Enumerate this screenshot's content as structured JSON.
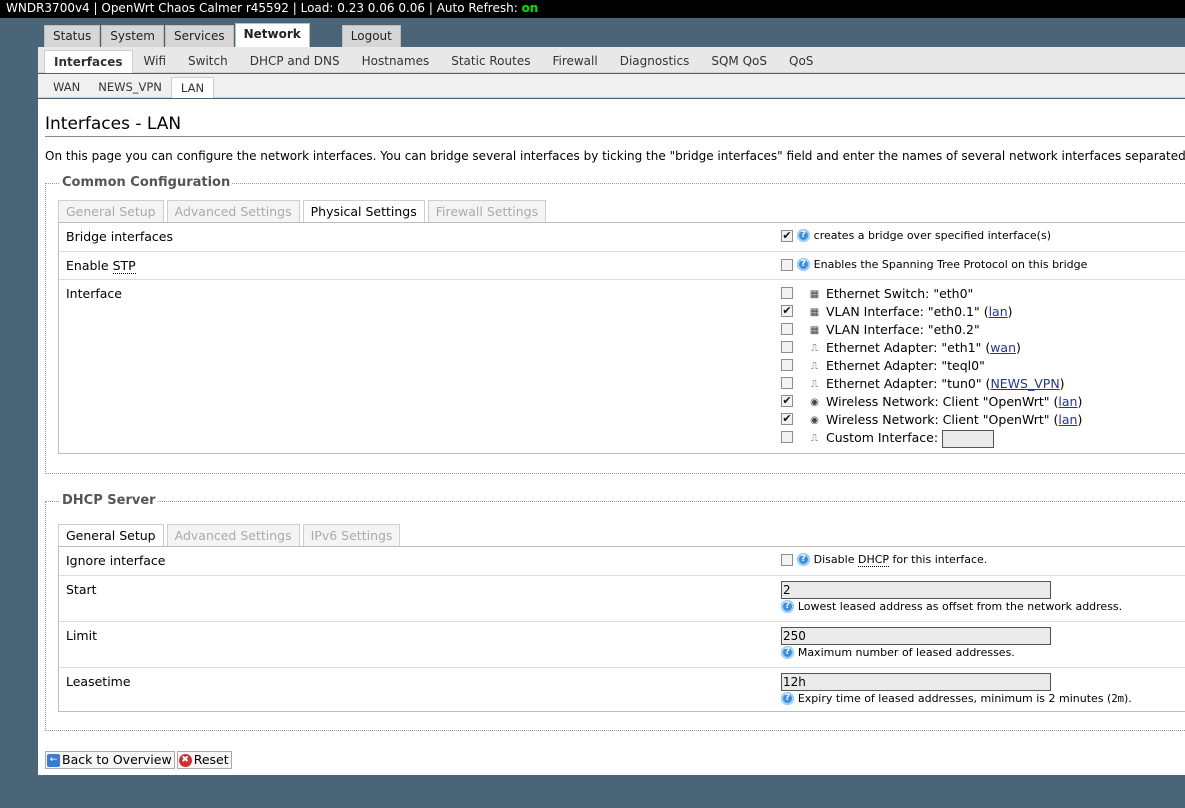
{
  "header": {
    "text": "WNDR3700v4 | OpenWrt Chaos Calmer r45592 | Load: 0.23 0.06 0.06 | Auto Refresh: ",
    "refresh_state": "on"
  },
  "main_tabs": [
    "Status",
    "System",
    "Services",
    "Network",
    "Logout"
  ],
  "network_tabs": [
    "Interfaces",
    "Wifi",
    "Switch",
    "DHCP and DNS",
    "Hostnames",
    "Static Routes",
    "Firewall",
    "Diagnostics",
    "SQM QoS",
    "QoS"
  ],
  "iface_tabs": [
    "WAN",
    "NEWS_VPN",
    "LAN"
  ],
  "page": {
    "title": "Interfaces - LAN",
    "description": "On this page you can configure the network interfaces. You can bridge several interfaces by ticking the \"bridge interfaces\" field and enter the names of several network interfaces separated by spa"
  },
  "common": {
    "legend": "Common Configuration",
    "tabs": [
      "General Setup",
      "Advanced Settings",
      "Physical Settings",
      "Firewall Settings"
    ],
    "bridge": {
      "label": "Bridge interfaces",
      "checked": true,
      "help": "creates a bridge over specified interface(s)"
    },
    "stp": {
      "label_pre": "Enable ",
      "label_abbr": "STP",
      "checked": false,
      "help": "Enables the Spanning Tree Protocol on this bridge"
    },
    "interface_label": "Interface",
    "interfaces": [
      {
        "text": "Ethernet Switch: \"eth0\"",
        "link": "",
        "checked": false,
        "icon": "switch-icon"
      },
      {
        "text": "VLAN Interface: \"eth0.1\" (",
        "link": "lan",
        "checked": true,
        "icon": "switch-icon"
      },
      {
        "text": "VLAN Interface: \"eth0.2\"",
        "link": "",
        "checked": false,
        "icon": "switch-icon"
      },
      {
        "text": "Ethernet Adapter: \"eth1\" (",
        "link": "wan",
        "checked": false,
        "icon": "ethernet-icon"
      },
      {
        "text": "Ethernet Adapter: \"teql0\"",
        "link": "",
        "checked": false,
        "icon": "ethernet-icon"
      },
      {
        "text": "Ethernet Adapter: \"tun0\" (",
        "link": "NEWS_VPN",
        "checked": false,
        "icon": "ethernet-icon"
      },
      {
        "text": "Wireless Network: Client \"OpenWrt\" (",
        "link": "lan",
        "checked": true,
        "icon": "wireless-icon"
      },
      {
        "text": "Wireless Network: Client \"OpenWrt\" (",
        "link": "lan",
        "checked": true,
        "icon": "wireless-icon"
      }
    ],
    "custom": {
      "label": "Custom Interface:",
      "value": ""
    }
  },
  "dhcp": {
    "legend": "DHCP Server",
    "tabs": [
      "General Setup",
      "Advanced Settings",
      "IPv6 Settings"
    ],
    "ignore": {
      "label": "Ignore interface",
      "checked": false,
      "help_pre": "Disable ",
      "help_abbr": "DHCP",
      "help_post": " for this interface."
    },
    "start": {
      "label": "Start",
      "value": "2",
      "help": "Lowest leased address as offset from the network address."
    },
    "limit": {
      "label": "Limit",
      "value": "250",
      "help": "Maximum number of leased addresses."
    },
    "leasetime": {
      "label": "Leasetime",
      "value": "12h",
      "help_pre": "Expiry time of leased addresses, minimum is 2 minutes (",
      "help_code": "2m",
      "help_post": ")."
    }
  },
  "buttons": {
    "back": "Back to Overview",
    "reset": "Reset"
  },
  "colors": {
    "background": "#4a6478",
    "refresh_on": "#00e000",
    "help": "#3d8fe0",
    "link": "#223399"
  }
}
